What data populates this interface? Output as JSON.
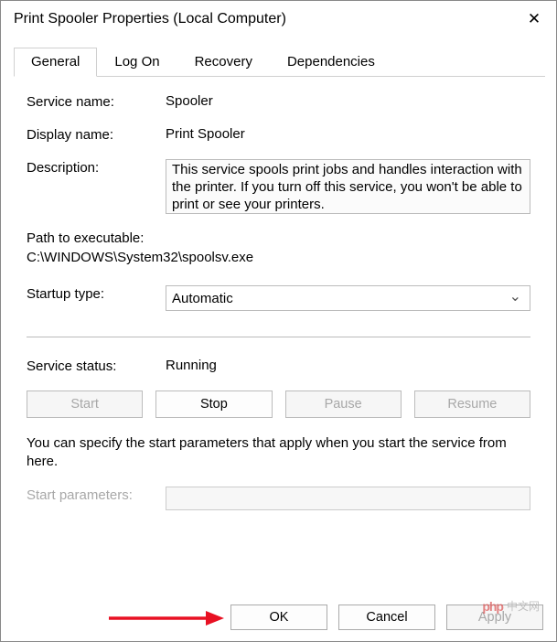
{
  "titlebar": {
    "title": "Print Spooler Properties (Local Computer)"
  },
  "tabs": {
    "general": "General",
    "logon": "Log On",
    "recovery": "Recovery",
    "dependencies": "Dependencies"
  },
  "labels": {
    "service_name": "Service name:",
    "display_name": "Display name:",
    "description": "Description:",
    "path_to_exe": "Path to executable:",
    "startup_type": "Startup type:",
    "service_status": "Service status:",
    "start_params": "Start parameters:"
  },
  "values": {
    "service_name": "Spooler",
    "display_name": "Print Spooler",
    "description": "This service spools print jobs and handles interaction with the printer.  If you turn off this service, you won't be able to print or see your printers.",
    "path": "C:\\WINDOWS\\System32\\spoolsv.exe",
    "startup_type": "Automatic",
    "service_status": "Running"
  },
  "buttons": {
    "start": "Start",
    "stop": "Stop",
    "pause": "Pause",
    "resume": "Resume",
    "ok": "OK",
    "cancel": "Cancel",
    "apply": "Apply"
  },
  "note": "You can specify the start parameters that apply when you start the service from here.",
  "watermark": "中文网"
}
